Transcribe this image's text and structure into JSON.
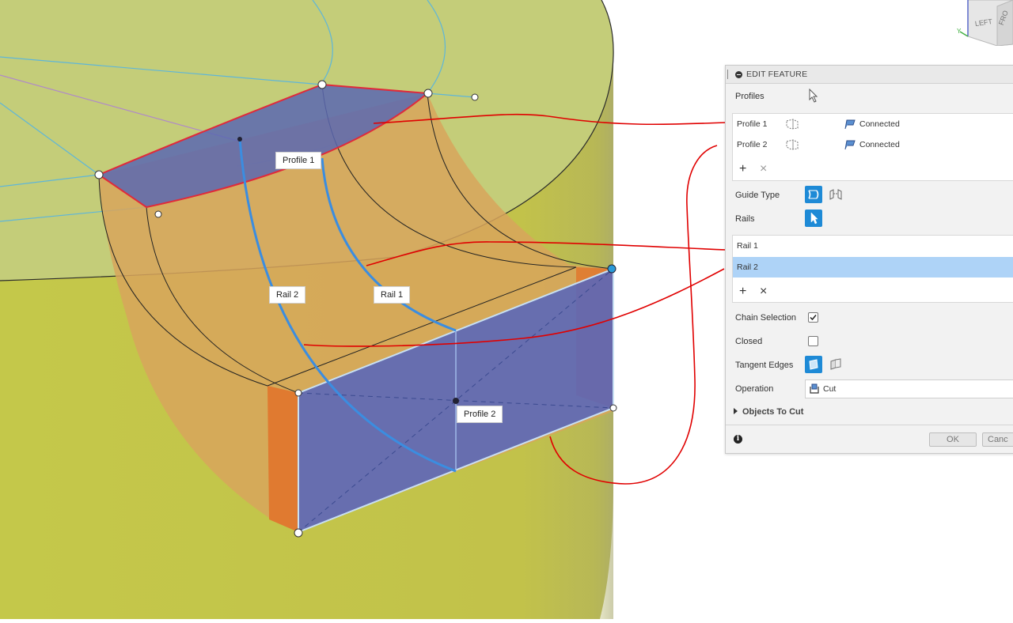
{
  "viewport": {
    "labels": {
      "profile_1": "Profile 1",
      "profile_2": "Profile 2",
      "rail_1": "Rail 1",
      "rail_2": "Rail 2"
    },
    "viewcube": {
      "left": "LEFT",
      "front": "FRO"
    },
    "colors": {
      "top_face": "#c3cd75",
      "side_wall": "#c2c249",
      "cut_face": "#d2a45c",
      "profile_fill": "#5b6ab4",
      "rail_line": "#3b8de0",
      "annotation": "#e00000"
    }
  },
  "panel": {
    "title": "EDIT FEATURE",
    "profiles_label": "Profiles",
    "profiles": [
      {
        "name": "Profile 1",
        "status": "Connected"
      },
      {
        "name": "Profile 2",
        "status": "Connected"
      }
    ],
    "guide_type_label": "Guide Type",
    "rails_label": "Rails",
    "rails": [
      {
        "name": "Rail 1",
        "selected": false
      },
      {
        "name": "Rail 2",
        "selected": true
      }
    ],
    "chain_selection_label": "Chain Selection",
    "chain_selection_checked": true,
    "closed_label": "Closed",
    "closed_checked": false,
    "tangent_edges_label": "Tangent Edges",
    "operation_label": "Operation",
    "operation_value": "Cut",
    "objects_to_cut_label": "Objects To Cut",
    "ok_label": "OK",
    "cancel_label": "Canc",
    "accent": "#1e8ad6",
    "selected_row_color": "#aed3f7"
  }
}
